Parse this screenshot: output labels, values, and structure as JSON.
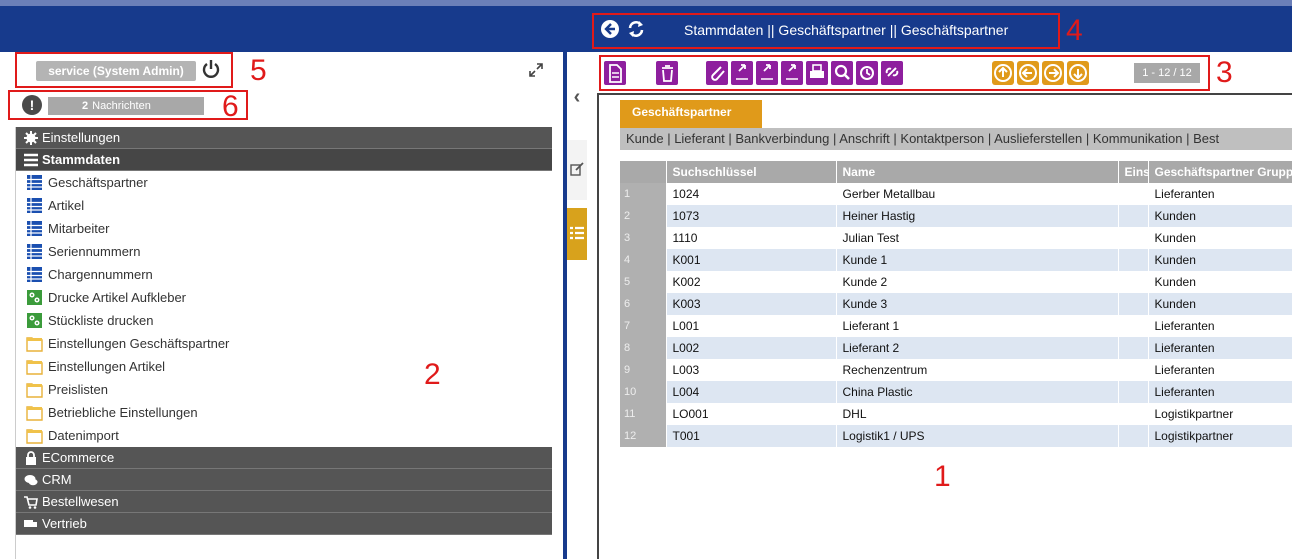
{
  "nav": {
    "title": "Stammdaten || Geschäftspartner  || Geschäftspartner"
  },
  "user": {
    "label": "service (System Admin)"
  },
  "messages": {
    "count": "2",
    "label": "Nachrichten"
  },
  "menu": {
    "sections": [
      {
        "label": "Einstellungen",
        "icon": "gear-icon"
      },
      {
        "label": "Stammdaten",
        "icon": "hamburger-icon"
      }
    ],
    "items": [
      {
        "label": "Geschäftspartner",
        "icon": "table-icon"
      },
      {
        "label": "Artikel",
        "icon": "table-icon"
      },
      {
        "label": "Mitarbeiter",
        "icon": "table-icon"
      },
      {
        "label": "Seriennummern",
        "icon": "table-icon"
      },
      {
        "label": "Chargennummern",
        "icon": "table-icon"
      },
      {
        "label": "Drucke Artikel Aufkleber",
        "icon": "process-icon"
      },
      {
        "label": "Stückliste drucken",
        "icon": "process-icon"
      },
      {
        "label": "Einstellungen Geschäftspartner",
        "icon": "folder-icon"
      },
      {
        "label": "Einstellungen Artikel",
        "icon": "folder-icon"
      },
      {
        "label": "Preislisten",
        "icon": "folder-icon"
      },
      {
        "label": "Betriebliche Einstellungen",
        "icon": "folder-icon"
      },
      {
        "label": "Datenimport",
        "icon": "folder-icon"
      }
    ],
    "bottom_sections": [
      {
        "label": "ECommerce",
        "icon": "lock-icon"
      },
      {
        "label": "CRM",
        "icon": "chat-icon"
      },
      {
        "label": "Bestellwesen",
        "icon": "cart-icon"
      },
      {
        "label": "Vertrieb",
        "icon": "truck-icon"
      }
    ]
  },
  "toolbar": {
    "pager": "1 - 12 / 12"
  },
  "tab": {
    "label": "Geschäftspartner"
  },
  "subtabs": {
    "text": "Kunde | Lieferant | Bankverbindung | Anschrift | Kontaktperson | Auslieferstellen | Kommunikation | Best"
  },
  "grid": {
    "columns": [
      "",
      "Suchschlüssel",
      "Name",
      "Eins",
      "Geschäftspartner Grupp"
    ],
    "rows": [
      [
        "1",
        "1024",
        "Gerber Metallbau",
        "",
        "Lieferanten"
      ],
      [
        "2",
        "1073",
        "Heiner Hastig",
        "",
        "Kunden"
      ],
      [
        "3",
        "1110",
        "Julian Test",
        "",
        "Kunden"
      ],
      [
        "4",
        "K001",
        "Kunde 1",
        "",
        "Kunden"
      ],
      [
        "5",
        "K002",
        "Kunde 2",
        "",
        "Kunden"
      ],
      [
        "6",
        "K003",
        "Kunde 3",
        "",
        "Kunden"
      ],
      [
        "7",
        "L001",
        "Lieferant 1",
        "",
        "Lieferanten"
      ],
      [
        "8",
        "L002",
        "Lieferant 2",
        "",
        "Lieferanten"
      ],
      [
        "9",
        "L003",
        "Rechenzentrum",
        "",
        "Lieferanten"
      ],
      [
        "10",
        "L004",
        "China Plastic",
        "",
        "Lieferanten"
      ],
      [
        "11",
        "LO001",
        "DHL",
        "",
        "Logistikpartner"
      ],
      [
        "12",
        "T001",
        "Logistik1 / UPS",
        "",
        "Logistikpartner"
      ]
    ]
  },
  "annotations": [
    "1",
    "2",
    "3",
    "4",
    "5",
    "6"
  ],
  "colors": {
    "header_blue": "#173a8c",
    "toolbar_purple": "#8e1f9e",
    "accent_orange": "#e09a1a",
    "annotation_red": "#e01a1a"
  }
}
